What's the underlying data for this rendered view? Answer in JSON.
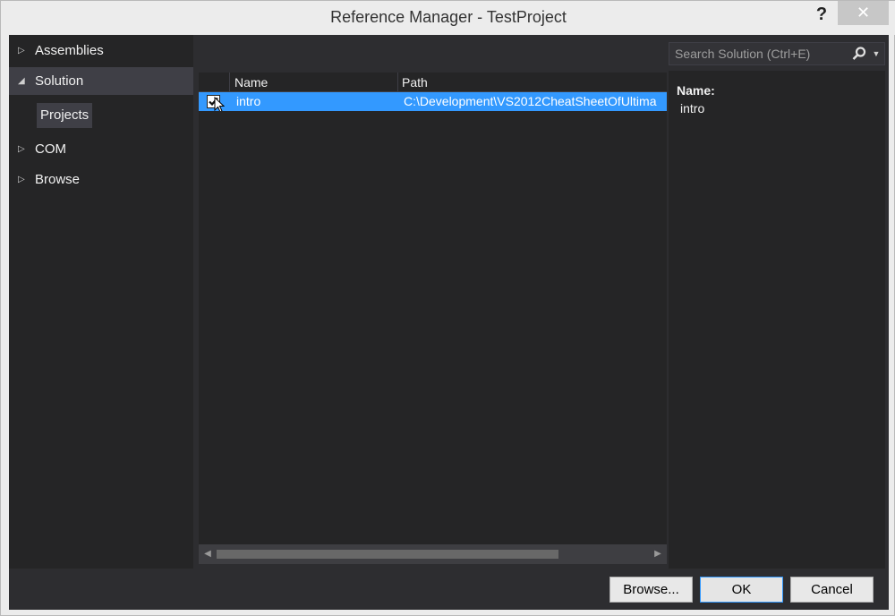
{
  "window": {
    "title": "Reference Manager - TestProject",
    "help_label": "?",
    "close_label": "✕"
  },
  "nav": {
    "items": [
      {
        "label": "Assemblies",
        "expanded": false
      },
      {
        "label": "Solution",
        "expanded": true
      },
      {
        "label": "COM",
        "expanded": false
      },
      {
        "label": "Browse",
        "expanded": false
      }
    ],
    "subitems": [
      {
        "label": "Projects"
      }
    ]
  },
  "grid": {
    "columns": [
      "Name",
      "Path"
    ],
    "rows": [
      {
        "checked": true,
        "name": "intro",
        "path": "C:\\Development\\VS2012CheatSheetOfUltima"
      }
    ]
  },
  "search": {
    "placeholder": "Search Solution (Ctrl+E)"
  },
  "details": {
    "label": "Name:",
    "value": "intro"
  },
  "buttons": {
    "browse": "Browse...",
    "ok": "OK",
    "cancel": "Cancel"
  },
  "colors": {
    "accent": "#3399ff",
    "panel_bg": "#252526",
    "chrome_bg": "#2d2d30"
  }
}
